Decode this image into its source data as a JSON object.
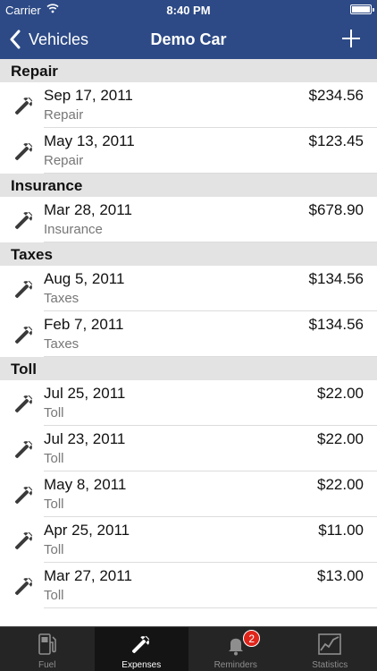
{
  "status_bar": {
    "carrier": "Carrier",
    "time": "8:40 PM"
  },
  "nav": {
    "back_label": "Vehicles",
    "title": "Demo Car",
    "add_icon": "plus-icon"
  },
  "colors": {
    "nav_bg": "#2d4a86",
    "section_bg": "#e3e3e3",
    "tab_bg": "#252525",
    "badge": "#e0251b"
  },
  "sections": [
    {
      "title": "Repair",
      "rows": [
        {
          "date": "Sep 17, 2011",
          "category": "Repair",
          "amount": "$234.56"
        },
        {
          "date": "May 13, 2011",
          "category": "Repair",
          "amount": "$123.45"
        }
      ]
    },
    {
      "title": "Insurance",
      "rows": [
        {
          "date": "Mar 28, 2011",
          "category": "Insurance",
          "amount": "$678.90"
        }
      ]
    },
    {
      "title": "Taxes",
      "rows": [
        {
          "date": "Aug 5, 2011",
          "category": "Taxes",
          "amount": "$134.56"
        },
        {
          "date": "Feb 7, 2011",
          "category": "Taxes",
          "amount": "$134.56"
        }
      ]
    },
    {
      "title": "Toll",
      "rows": [
        {
          "date": "Jul 25, 2011",
          "category": "Toll",
          "amount": "$22.00"
        },
        {
          "date": "Jul 23, 2011",
          "category": "Toll",
          "amount": "$22.00"
        },
        {
          "date": "May 8, 2011",
          "category": "Toll",
          "amount": "$22.00"
        },
        {
          "date": "Apr 25, 2011",
          "category": "Toll",
          "amount": "$11.00"
        },
        {
          "date": "Mar 27, 2011",
          "category": "Toll",
          "amount": "$13.00"
        }
      ]
    }
  ],
  "tabs": [
    {
      "label": "Fuel",
      "icon": "fuel-pump-icon"
    },
    {
      "label": "Expenses",
      "icon": "wrench-icon",
      "active": true
    },
    {
      "label": "Reminders",
      "icon": "bell-icon",
      "badge": "2"
    },
    {
      "label": "Statistics",
      "icon": "chart-icon"
    }
  ]
}
